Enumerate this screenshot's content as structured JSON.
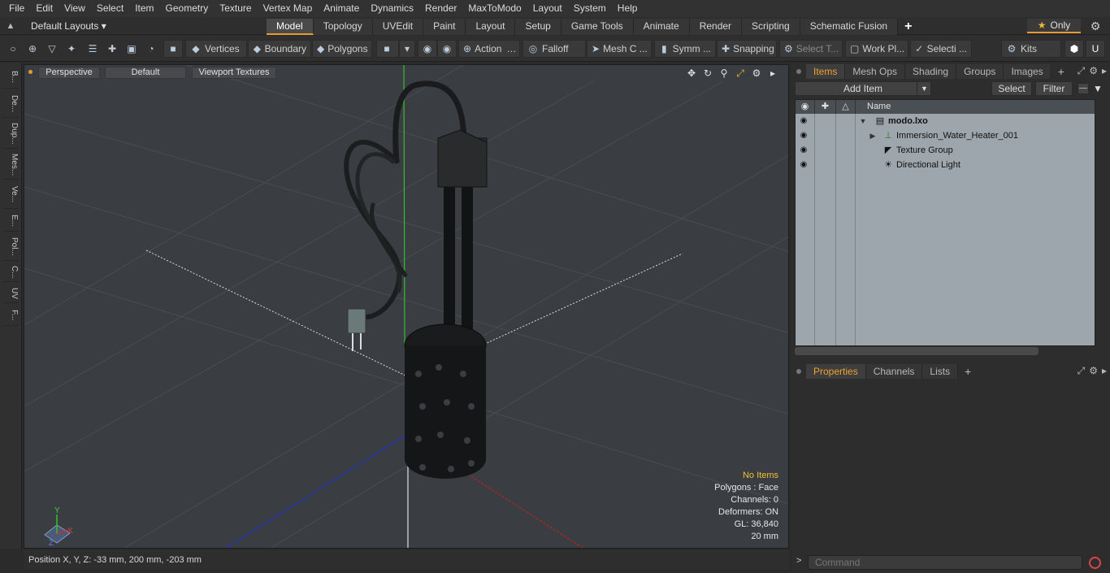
{
  "menu": [
    "File",
    "Edit",
    "View",
    "Select",
    "Item",
    "Geometry",
    "Texture",
    "Vertex Map",
    "Animate",
    "Dynamics",
    "Render",
    "MaxToModo",
    "Layout",
    "System",
    "Help"
  ],
  "layout": {
    "selector": "Default Layouts ▾",
    "tabs": [
      "Model",
      "Topology",
      "UVEdit",
      "Paint",
      "Layout",
      "Setup",
      "Game Tools",
      "Animate",
      "Render",
      "Scripting",
      "Schematic Fusion"
    ],
    "active_tab": "Model",
    "add_tab": "+",
    "only_label": "Only"
  },
  "toolbar": {
    "vertices": "Vertices",
    "boundary": "Boundary",
    "polygons": "Polygons",
    "action": "Action",
    "falloff": "Falloff",
    "mesh": "Mesh C ...",
    "symm": "Symm ...",
    "snapping": "Snapping",
    "select_t": "Select T...",
    "work_pl": "Work Pl...",
    "selecti": "Selecti ...",
    "kits": "Kits"
  },
  "left_tabs": [
    "B...",
    "De...",
    "Dup...",
    "Mes...",
    "Ve...",
    "E...",
    "Pol...",
    "C...",
    "UV",
    "F..."
  ],
  "viewport": {
    "perspective": "Perspective",
    "default": "Default",
    "textures": "Viewport Textures",
    "info": {
      "no_items": "No Items",
      "polygons": "Polygons : Face",
      "channels": "Channels: 0",
      "deformers": "Deformers: ON",
      "gl": "GL: 36,840",
      "scale": "20 mm"
    },
    "axis": {
      "x": "X",
      "y": "Y",
      "z": "Z"
    }
  },
  "status": {
    "position": "Position X, Y, Z:   -33 mm, 200 mm, -203 mm"
  },
  "items_panel": {
    "tabs": [
      "Items",
      "Mesh Ops",
      "Shading",
      "Groups",
      "Images"
    ],
    "active_tab": "Items",
    "add_tab": "+",
    "add_item": "Add Item",
    "select": "Select",
    "filter": "Filter",
    "column_name": "Name",
    "rows": [
      {
        "label": "modo.lxo"
      },
      {
        "label": "Immersion_Water_Heater_001"
      },
      {
        "label": "Texture Group"
      },
      {
        "label": "Directional Light"
      }
    ]
  },
  "props_panel": {
    "tabs": [
      "Properties",
      "Channels",
      "Lists"
    ],
    "active_tab": "Properties",
    "add_tab": "+"
  },
  "command": {
    "placeholder": "Command"
  },
  "colors": {
    "accent": "#e89a30",
    "viewport_bg": "#3a3e42",
    "items_bg": "#9ea6ad"
  }
}
